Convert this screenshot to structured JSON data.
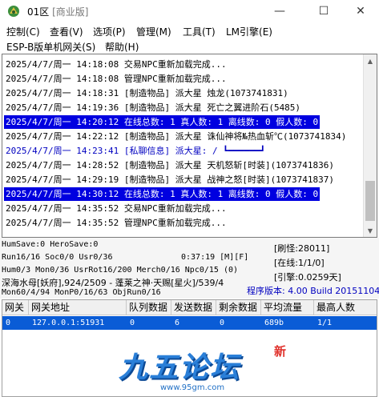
{
  "window": {
    "title_main": "01区 ",
    "title_edition": "[商业版]",
    "min_glyph": "—",
    "max_glyph": "☐",
    "close_glyph": "✕"
  },
  "menu": {
    "row1": [
      "控制(C)",
      "查看(V)",
      "选项(P)",
      "管理(M)",
      "工具(T)",
      "LM引擎(E)"
    ],
    "row2": [
      "ESP-B版单机网关(S)",
      "帮助(H)"
    ]
  },
  "log": [
    {
      "text": "2025/4/7/周一 14:18:08 交易NPC重新加载完成...",
      "style": "normal"
    },
    {
      "text": "2025/4/7/周一 14:18:08 管理NPC重新加载完成...",
      "style": "normal"
    },
    {
      "text": "2025/4/7/周一 14:18:31 [制造物品] 派大星 烛龙(1073741831)",
      "style": "normal"
    },
    {
      "text": "2025/4/7/周一 14:19:36 [制造物品] 派大星 死亡之翼进阶石(5485)",
      "style": "normal"
    },
    {
      "text": "2025/4/7/周一 14:20:12 在线总数: 1 真人数: 1 离线数: 0 假人数: 0",
      "style": "highlight"
    },
    {
      "text": "2025/4/7/周一 14:22:12 [制造物品] 派大星 诛仙神将№热血斩℃(1073741834)",
      "style": "normal"
    },
    {
      "text": "2025/4/7/周一 14:23:41 [私聊信息] 派大星: / ┗━━━━━━┛",
      "style": "blue"
    },
    {
      "text": "2025/4/7/周一 14:28:52 [制造物品] 派大星 天机怒斩[时装](1073741836)",
      "style": "normal"
    },
    {
      "text": "2025/4/7/周一 14:29:19 [制造物品] 派大星 战神之怒[时装](1073741837)",
      "style": "normal"
    },
    {
      "text": "2025/4/7/周一 14:30:12 在线总数: 1 真人数: 1 离线数: 0 假人数: 0",
      "style": "highlight"
    },
    {
      "text": "2025/4/7/周一 14:35:52 交易NPC重新加载完成...",
      "style": "normal"
    },
    {
      "text": "2025/4/7/周一 14:35:52 管理NPC重新加载完成...",
      "style": "normal"
    }
  ],
  "status": {
    "line1": "HumSave:0 HeroSave:0",
    "line2a": "Run16/16 Soc0/0 Usr0/36",
    "line2b": "0:37:19 [M][F]",
    "line3": "Hum0/3 Mon0/36 UsrRot16/200 Merch0/16 Npc0/15 (0)",
    "line4": "深海水母[妖府],924/2509 - 蓬莱之神·天赐[星火]/539/4",
    "line5": "Mon60/4/94 MonP0/16/63 ObjRun0/16",
    "refresh": "[刷怪:28011]",
    "online": "[在线:1/1/0]",
    "engine": "[引擎:0.0259天]",
    "version": "程序版本: 4.00 Build 20151104"
  },
  "gateway_table": {
    "headers": [
      "网关",
      "网关地址",
      "队列数据",
      "发送数据",
      "剩余数据",
      "平均流量",
      "最高人数"
    ],
    "rows": [
      [
        "0",
        "127.0.0.1:51931",
        "0",
        "6",
        "0",
        "689b",
        "1/1"
      ]
    ]
  },
  "watermark": {
    "logo_text": "九五论坛",
    "badge": "新",
    "url": "www.95gm.com"
  }
}
